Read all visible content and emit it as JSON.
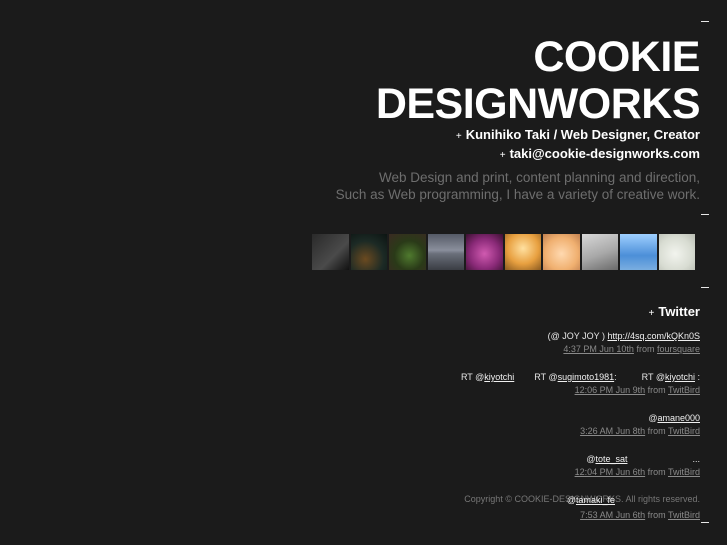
{
  "header": {
    "title_line1": "COOKIE",
    "title_line2": "DESIGNWORKS",
    "plus": "+",
    "subtitle": "Kunihiko Taki / Web Designer, Creator",
    "email": "taki@cookie-designworks.com",
    "desc_line1": "Web Design and print, content planning and direction,",
    "desc_line2": "Such as Web programming, I have a variety of creative work."
  },
  "twitter": {
    "heading": "Twitter",
    "tweets": [
      {
        "pre": "(@ JOY JOY      ) ",
        "link": "http://4sq.com/kQKn0S",
        "time": "4:37 PM Jun 10th",
        "from": "from",
        "source": "foursquare"
      },
      {
        "pre": "RT @",
        "u1": "kiyotchi",
        "mid1": "        RT @",
        "u2": "sugimoto1981",
        "mid2": ":          RT @",
        "u3": "kiyotchi",
        "post": " :",
        "time": "12:06 PM Jun 9th",
        "from": "from",
        "source": "TwitBird"
      },
      {
        "pre": "@",
        "u1": "amane000",
        "time": "3:26 AM Jun 8th",
        "from": "from",
        "source": "TwitBird"
      },
      {
        "pre": "@",
        "u1": "tote_sat",
        "post": "                          ...",
        "time": "12:04 PM Jun 6th",
        "from": "from",
        "source": "TwitBird"
      },
      {
        "pre": "@",
        "u1": "tamaki_fe",
        "time": "7:53 AM Jun 6th",
        "from": "from",
        "source": "TwitBird"
      }
    ]
  },
  "footer": {
    "copyright": "Copyright © COOKIE-DESIGNWORKS. All rights reserved."
  },
  "colors": {
    "background": "#1b1b1b",
    "text": "#ffffff",
    "muted": "#6e6e6e"
  }
}
